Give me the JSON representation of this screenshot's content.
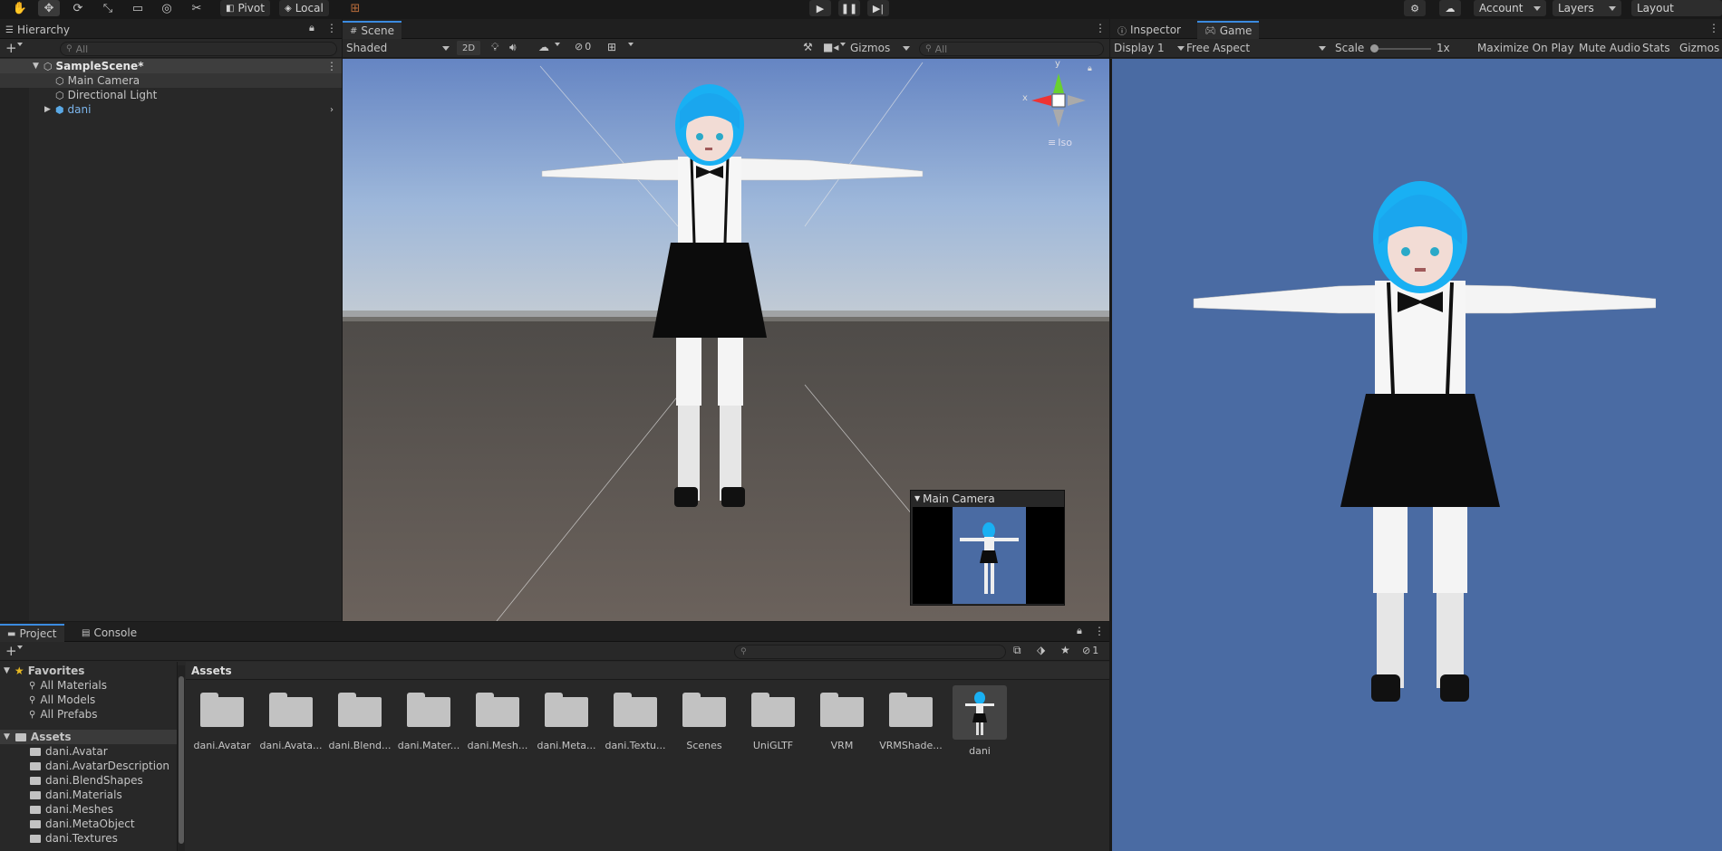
{
  "toolbar": {
    "pivot_label": "Pivot",
    "local_label": "Local",
    "account_label": "Account",
    "layers_label": "Layers",
    "layout_label": "Layout"
  },
  "hierarchy": {
    "tab_label": "Hierarchy",
    "search_placeholder": "All",
    "scene_name": "SampleScene*",
    "items": [
      {
        "label": "Main Camera"
      },
      {
        "label": "Directional Light"
      },
      {
        "label": "dani"
      }
    ]
  },
  "scene": {
    "tab_label": "Scene",
    "shading_mode": "Shaded",
    "mode_2d": "2D",
    "hidden_count": "0",
    "gizmos_label": "Gizmos",
    "search_placeholder": "All",
    "axis_y": "y",
    "axis_x": "x",
    "projection": "Iso",
    "camera_preview_title": "Main Camera"
  },
  "game": {
    "inspector_tab": "Inspector",
    "game_tab": "Game",
    "display": "Display 1",
    "aspect": "Free Aspect",
    "scale_label": "Scale",
    "scale_value": "1x",
    "maximize_label": "Maximize On Play",
    "mute_label": "Mute Audio",
    "stats_label": "Stats",
    "gizmos_label": "Gizmos",
    "background_color": "#4a6ba3"
  },
  "project": {
    "project_tab": "Project",
    "console_tab": "Console",
    "hidden_count": "1",
    "favorites_label": "Favorites",
    "favorites": [
      "All Materials",
      "All Models",
      "All Prefabs"
    ],
    "assets_label": "Assets",
    "assets_tree": [
      "dani.Avatar",
      "dani.AvatarDescription",
      "dani.BlendShapes",
      "dani.Materials",
      "dani.Meshes",
      "dani.MetaObject",
      "dani.Textures"
    ],
    "breadcrumb": "Assets",
    "tiles": [
      "dani.Avatar",
      "dani.Avata...",
      "dani.Blend...",
      "dani.Mater...",
      "dani.Mesh...",
      "dani.Meta...",
      "dani.Textu...",
      "Scenes",
      "UniGLTF",
      "VRM",
      "VRMShade...",
      "dani"
    ]
  }
}
